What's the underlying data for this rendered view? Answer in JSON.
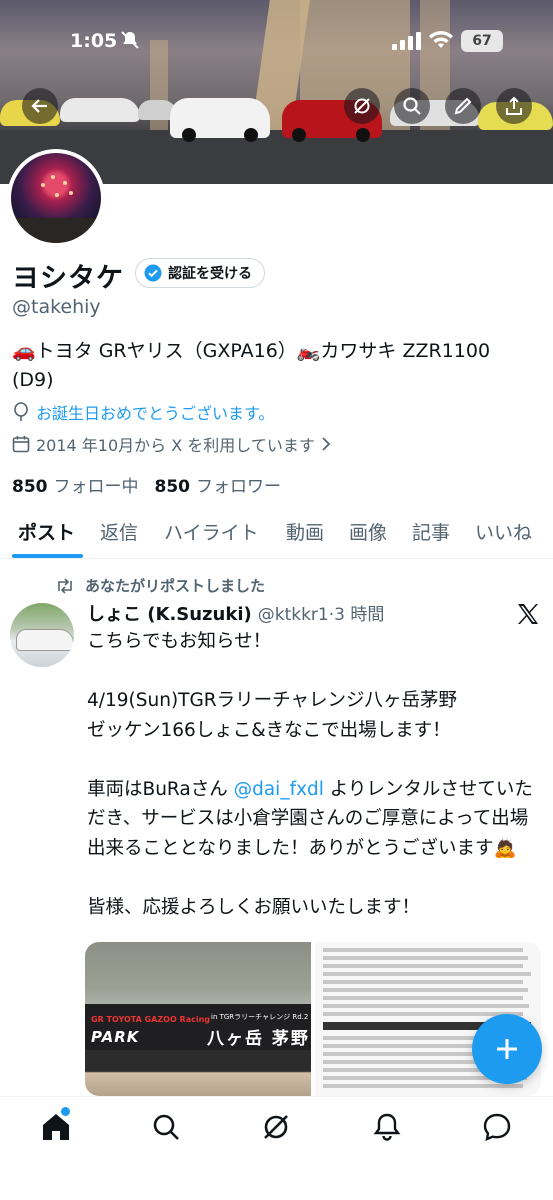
{
  "status_bar": {
    "time": "1:05",
    "battery": "67"
  },
  "profile": {
    "name": "ヨシタケ",
    "verify_label": "認証を受ける",
    "handle": "@takehiy",
    "bio_line1": "🚗トヨタ GRヤリス（GXPA16）🏍️カワサキ ZZR1100",
    "bio_line2": "(D9)",
    "birthday_text": "お誕生日おめでとうございます。",
    "joined_text": "2014 年10月から X を利用しています",
    "following_count": "850",
    "following_label": "フォロー中",
    "followers_count": "850",
    "followers_label": "フォロワー"
  },
  "tabs": [
    "ポスト",
    "返信",
    "ハイライト",
    "動画",
    "画像",
    "記事",
    "いいね"
  ],
  "post": {
    "repost_label": "あなたがリポストしました",
    "author_name": "しょこ (K.Suzuki)",
    "author_meta": "@ktkkr1·3 時間",
    "text_line1": "こちらでもお知らせ！",
    "text_para2": "4/19(Sun)TGRラリーチャレンジ八ヶ岳茅野\nゼッケン166しょこ&きなこで出場します！",
    "text_para3_a": "車両はBuRaさん ",
    "mention": "@dai_fxdl",
    "text_para3_b": " よりレンタルさせていただき、サービスは小倉学園さんのご厚意によって出場出来ることとなりました！ありがとうございます🙇",
    "text_para4": "皆様、応援よろしくお願いいたします！",
    "media1": {
      "brand_text": "GR TOYOTA GAZOO Racing",
      "park_text": "PARK",
      "event_text": "in TGRラリーチャレンジ Rd.2",
      "place_text": "八ヶ岳 茅野"
    }
  },
  "colors": {
    "accent": "#1d9bf0",
    "secondary_text": "#536471",
    "primary_text": "#0f1419"
  },
  "icons": {
    "header": [
      "back-arrow-icon",
      "grok-icon",
      "search-icon",
      "edit-icon",
      "share-icon"
    ],
    "bottom_nav": [
      "home-icon",
      "search-icon",
      "grok-icon",
      "notifications-icon",
      "messages-icon"
    ]
  }
}
